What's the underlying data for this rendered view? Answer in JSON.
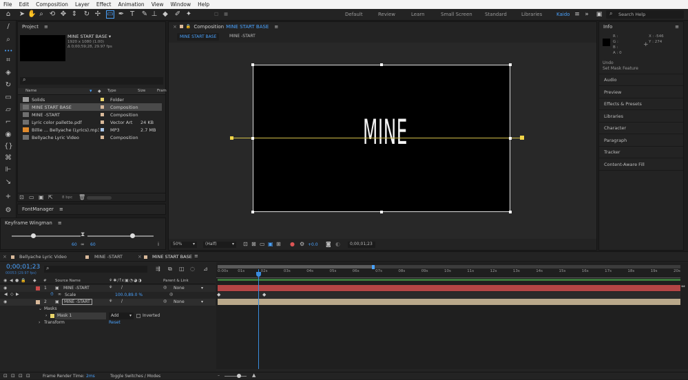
{
  "menu": [
    "File",
    "Edit",
    "Composition",
    "Layer",
    "Effect",
    "Animation",
    "View",
    "Window",
    "Help"
  ],
  "workspaces": [
    "Default",
    "Review",
    "Learn",
    "Small Screen",
    "Standard",
    "Libraries",
    "Kaido"
  ],
  "search_placeholder": "Search Help",
  "project": {
    "title": "Project",
    "comp_name": "MINE START BASE ▾",
    "comp_info1": "1920 x 1080 (1.00)",
    "comp_info2": "Δ 0;00;59;28, 29.97 fps",
    "columns": [
      "Name",
      "Type",
      "Size",
      "Fram"
    ],
    "items": [
      {
        "name": "Solids",
        "type": "Folder",
        "size": "",
        "color": "#e8d36a"
      },
      {
        "name": "MINE START BASE",
        "type": "Composition",
        "size": "",
        "color": "#d9b99a"
      },
      {
        "name": "MINE -START",
        "type": "Composition",
        "size": "",
        "color": "#d9b99a"
      },
      {
        "name": "Lyric color pallette.pdf",
        "type": "Vector Art",
        "size": "24 KB",
        "color": "#d9b99a"
      },
      {
        "name": "Billie ... Bellyache (Lyrics).mp3",
        "type": "MP3",
        "size": "2.7 MB",
        "color": "#a9c4e6"
      },
      {
        "name": "Bellyache Lyric Video",
        "type": "Composition",
        "size": "",
        "color": "#d9b99a"
      }
    ],
    "bpc": "8 bpc"
  },
  "fontmanager": "FontManager",
  "kwingman": {
    "title": "Keyframe Wingman",
    "left": "60",
    "right": "60"
  },
  "comp_panel": {
    "title": "Composition",
    "comp": "MINE START BASE",
    "tab1": "MINE START BASE",
    "tab2": "MINE -START",
    "overlay_text": "MINE",
    "zoom": "50%",
    "res": "(Half)",
    "exposure": "+0.0",
    "timecode": "0;00;01;23"
  },
  "info": {
    "title": "Info",
    "r": "R :",
    "g": "G :",
    "b": "B :",
    "a": "A :  0",
    "x": "X : -546",
    "y": "Y :  274",
    "undo": "Undo",
    "undo_detail": "Set Mask Feature",
    "panels": [
      "Audio",
      "Preview",
      "Effects & Presets",
      "Libraries",
      "Character",
      "Paragraph",
      "Tracker",
      "Content-Aware Fill"
    ]
  },
  "timeline": {
    "tabs": [
      "Bellyache Lyric Video",
      "MINE -START",
      "MINE START BASE"
    ],
    "timecode": "0;00;01;23",
    "frames": "00053 (29.97 fps)",
    "col_source": "Source Name",
    "col_parent": "Parent & Link",
    "layers": [
      {
        "num": "1",
        "name": "MINE -START",
        "parent": "None"
      },
      {
        "num": "2",
        "name": "MINE -START",
        "parent": "None"
      }
    ],
    "scale_label": "Scale",
    "scale_value": "100.0,89.0 %",
    "masks": "Masks",
    "mask1": "Mask 1",
    "mode": "Add",
    "inverted": "Inverted",
    "transform": "Transform",
    "reset": "Reset",
    "ruler": [
      "0:00s",
      "01s",
      "02s",
      "03s",
      "04s",
      "05s",
      "06s",
      "07s",
      "08s",
      "09s",
      "10s",
      "11s",
      "12s",
      "13s",
      "14s",
      "15s",
      "16s",
      "17s",
      "18s",
      "19s",
      "20s"
    ],
    "render_label": "Frame Render Time:",
    "render_value": "2ms",
    "toggle": "Toggle Switches / Modes"
  }
}
